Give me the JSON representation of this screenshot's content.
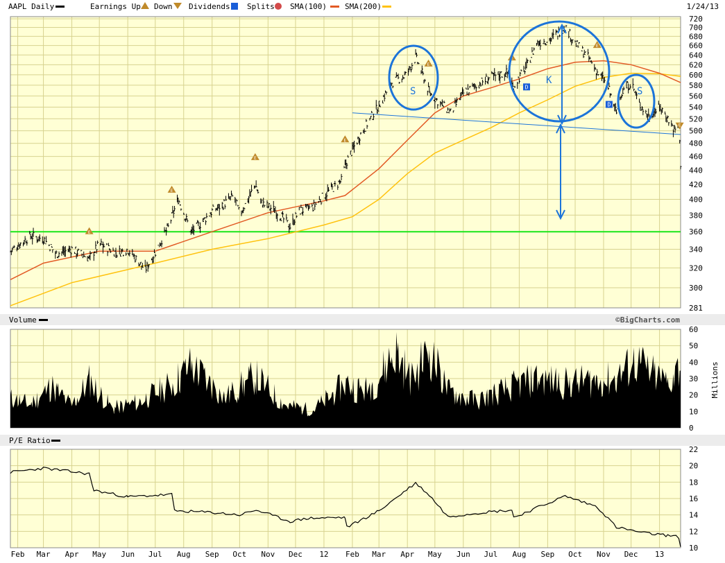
{
  "header": {
    "symbol_label": "AAPL Daily",
    "earnings_label": "Earnings Up",
    "down_label": "Down",
    "dividends_label": "Dividends",
    "splits_label": "Splits",
    "sma100_label": "SMA(100)",
    "sma200_label": "SMA(200)",
    "date": "1/24/13"
  },
  "panels": {
    "volume_label": "Volume",
    "volume_unit": "Millions",
    "pe_label": "P/E Ratio",
    "credit": "©BigCharts.com"
  },
  "colors": {
    "panel_bg": "#ffffd5",
    "grid": "#d7d28f",
    "sma100": "#e25a25",
    "sma200": "#ffc20e",
    "support": "#19e619",
    "annotation": "#1c74d9",
    "earnings_marker": "#c08a2a",
    "dividend_marker": "#1a5ed8"
  },
  "annotations": {
    "left_shoulder": "S",
    "head": "K",
    "right_shoulder": "S"
  },
  "markers": {
    "earnings_glyph": "E",
    "dividend_glyph": "D"
  },
  "chart_data": [
    {
      "type": "line",
      "panel": "price",
      "scale": "log",
      "y_ticks": [
        281,
        300,
        320,
        340,
        360,
        380,
        400,
        420,
        440,
        460,
        480,
        500,
        520,
        540,
        560,
        580,
        600,
        620,
        640,
        660,
        680,
        700,
        720
      ],
      "ylim": [
        281,
        725
      ],
      "x_labels": [
        "Feb",
        "Mar",
        "Apr",
        "May",
        "Jun",
        "Jul",
        "Aug",
        "Sep",
        "Oct",
        "Nov",
        "Dec",
        "12",
        "Feb",
        "Mar",
        "Apr",
        "May",
        "Jun",
        "Jul",
        "Aug",
        "Sep",
        "Oct",
        "Nov",
        "Dec",
        "13"
      ],
      "x_start": "2011-01-24",
      "x_end": "2013-01-24",
      "series": [
        {
          "name": "AAPL Daily",
          "style": "ohlc",
          "points": [
            [
              "2011-01-24",
              338
            ],
            [
              "2011-02-15",
              355
            ],
            [
              "2011-03-01",
              352
            ],
            [
              "2011-03-15",
              335
            ],
            [
              "2011-04-01",
              340
            ],
            [
              "2011-04-20",
              330
            ],
            [
              "2011-05-01",
              346
            ],
            [
              "2011-05-20",
              336
            ],
            [
              "2011-06-01",
              340
            ],
            [
              "2011-06-20",
              318
            ],
            [
              "2011-06-30",
              335
            ],
            [
              "2011-07-15",
              365
            ],
            [
              "2011-07-26",
              400
            ],
            [
              "2011-08-09",
              360
            ],
            [
              "2011-08-20",
              370
            ],
            [
              "2011-09-01",
              385
            ],
            [
              "2011-09-15",
              395
            ],
            [
              "2011-09-25",
              405
            ],
            [
              "2011-10-01",
              380
            ],
            [
              "2011-10-10",
              400
            ],
            [
              "2011-10-18",
              420
            ],
            [
              "2011-10-25",
              395
            ],
            [
              "2011-11-10",
              385
            ],
            [
              "2011-11-25",
              366
            ],
            [
              "2011-12-05",
              385
            ],
            [
              "2011-12-20",
              390
            ],
            [
              "2012-01-01",
              405
            ],
            [
              "2012-01-20",
              425
            ],
            [
              "2012-01-25",
              450
            ],
            [
              "2012-02-10",
              495
            ],
            [
              "2012-02-29",
              540
            ],
            [
              "2012-03-15",
              585
            ],
            [
              "2012-03-31",
              600
            ],
            [
              "2012-04-10",
              635
            ],
            [
              "2012-04-25",
              565
            ],
            [
              "2012-05-18",
              530
            ],
            [
              "2012-06-01",
              565
            ],
            [
              "2012-06-20",
              585
            ],
            [
              "2012-07-01",
              595
            ],
            [
              "2012-07-20",
              605
            ],
            [
              "2012-07-25",
              575
            ],
            [
              "2012-08-10",
              620
            ],
            [
              "2012-08-20",
              665
            ],
            [
              "2012-09-05",
              675
            ],
            [
              "2012-09-20",
              702
            ],
            [
              "2012-10-01",
              665
            ],
            [
              "2012-10-15",
              635
            ],
            [
              "2012-10-25",
              605
            ],
            [
              "2012-11-05",
              580
            ],
            [
              "2012-11-15",
              530
            ],
            [
              "2012-11-20",
              565
            ],
            [
              "2012-12-01",
              585
            ],
            [
              "2012-12-10",
              545
            ],
            [
              "2012-12-20",
              525
            ],
            [
              "2013-01-02",
              540
            ],
            [
              "2013-01-10",
              520
            ],
            [
              "2013-01-18",
              500
            ],
            [
              "2013-01-22",
              510
            ],
            [
              "2013-01-24",
              450
            ]
          ]
        },
        {
          "name": "SMA(100)",
          "points": [
            [
              "2011-01-24",
              308
            ],
            [
              "2011-03-01",
              325
            ],
            [
              "2011-05-01",
              338
            ],
            [
              "2011-07-01",
              338
            ],
            [
              "2011-09-01",
              360
            ],
            [
              "2011-11-01",
              383
            ],
            [
              "2012-01-01",
              398
            ],
            [
              "2012-01-24",
              405
            ],
            [
              "2012-03-01",
              442
            ],
            [
              "2012-04-01",
              485
            ],
            [
              "2012-05-01",
              530
            ],
            [
              "2012-06-01",
              560
            ],
            [
              "2012-07-01",
              575
            ],
            [
              "2012-08-01",
              592
            ],
            [
              "2012-09-01",
              612
            ],
            [
              "2012-10-01",
              625
            ],
            [
              "2012-11-01",
              628
            ],
            [
              "2012-12-01",
              620
            ],
            [
              "2013-01-01",
              603
            ],
            [
              "2013-01-24",
              585
            ]
          ]
        },
        {
          "name": "SMA(200)",
          "points": [
            [
              "2011-01-24",
              283
            ],
            [
              "2011-04-01",
              305
            ],
            [
              "2011-07-01",
              325
            ],
            [
              "2011-09-01",
              340
            ],
            [
              "2011-11-01",
              352
            ],
            [
              "2012-01-01",
              368
            ],
            [
              "2012-02-01",
              378
            ],
            [
              "2012-03-01",
              400
            ],
            [
              "2012-04-01",
              435
            ],
            [
              "2012-05-01",
              465
            ],
            [
              "2012-06-01",
              485
            ],
            [
              "2012-07-01",
              505
            ],
            [
              "2012-08-01",
              530
            ],
            [
              "2012-09-01",
              553
            ],
            [
              "2012-10-01",
              578
            ],
            [
              "2012-11-01",
              595
            ],
            [
              "2012-12-01",
              603
            ],
            [
              "2013-01-01",
              602
            ],
            [
              "2013-01-24",
              597
            ]
          ]
        },
        {
          "name": "Support",
          "points": [
            [
              "2011-01-24",
              360
            ],
            [
              "2013-01-24",
              360
            ]
          ]
        },
        {
          "name": "Neckline",
          "points": [
            [
              "2012-02-01",
              530
            ],
            [
              "2013-01-24",
              494
            ]
          ]
        }
      ],
      "earnings_up": [
        "2011-04-20",
        "2011-07-19",
        "2011-10-18",
        "2012-01-24",
        "2012-04-24",
        "2012-07-24",
        "2012-10-25"
      ],
      "earnings_down": [
        "2013-01-23"
      ],
      "dividends": [
        "2012-08-09",
        "2012-11-07"
      ]
    },
    {
      "type": "area",
      "panel": "volume",
      "ylabel": "Millions",
      "y_ticks": [
        0,
        10,
        20,
        30,
        40,
        50,
        60
      ],
      "ylim": [
        0,
        60
      ],
      "series": [
        {
          "name": "Volume",
          "points": [
            [
              "2011-01-24",
              20
            ],
            [
              "2011-02-15",
              16
            ],
            [
              "2011-03-10",
              28
            ],
            [
              "2011-04-01",
              15
            ],
            [
              "2011-04-20",
              32
            ],
            [
              "2011-05-15",
              13
            ],
            [
              "2011-06-15",
              18
            ],
            [
              "2011-07-20",
              30
            ],
            [
              "2011-08-09",
              42
            ],
            [
              "2011-09-15",
              20
            ],
            [
              "2011-10-18",
              35
            ],
            [
              "2011-11-20",
              15
            ],
            [
              "2011-12-20",
              12
            ],
            [
              "2012-01-25",
              30
            ],
            [
              "2012-02-15",
              25
            ],
            [
              "2012-03-01",
              34
            ],
            [
              "2012-03-19",
              53
            ],
            [
              "2012-04-05",
              32
            ],
            [
              "2012-04-25",
              52
            ],
            [
              "2012-05-15",
              25
            ],
            [
              "2012-06-15",
              18
            ],
            [
              "2012-07-25",
              28
            ],
            [
              "2012-08-20",
              33
            ],
            [
              "2012-09-20",
              30
            ],
            [
              "2012-10-25",
              32
            ],
            [
              "2012-11-15",
              33
            ],
            [
              "2012-12-05",
              45
            ],
            [
              "2012-12-20",
              38
            ],
            [
              "2013-01-10",
              30
            ],
            [
              "2013-01-24",
              42
            ]
          ]
        }
      ]
    },
    {
      "type": "line",
      "panel": "pe",
      "y_ticks": [
        10,
        12,
        14,
        16,
        18,
        20,
        22
      ],
      "ylim": [
        10,
        22
      ],
      "series": [
        {
          "name": "P/E Ratio",
          "points": [
            [
              "2011-01-24",
              19.2
            ],
            [
              "2011-03-01",
              19.7
            ],
            [
              "2011-04-20",
              19.0
            ],
            [
              "2011-04-25",
              17.0
            ],
            [
              "2011-06-01",
              16.2
            ],
            [
              "2011-07-19",
              16.5
            ],
            [
              "2011-07-22",
              14.5
            ],
            [
              "2011-09-01",
              14.3
            ],
            [
              "2011-10-01",
              14.0
            ],
            [
              "2011-10-19",
              14.6
            ],
            [
              "2011-11-25",
              13.2
            ],
            [
              "2011-12-15",
              13.6
            ],
            [
              "2012-01-24",
              13.7
            ],
            [
              "2012-01-26",
              12.5
            ],
            [
              "2012-03-01",
              14.5
            ],
            [
              "2012-04-10",
              17.9
            ],
            [
              "2012-04-25",
              16.4
            ],
            [
              "2012-05-15",
              13.8
            ],
            [
              "2012-06-20",
              14.3
            ],
            [
              "2012-07-24",
              14.6
            ],
            [
              "2012-07-26",
              13.7
            ],
            [
              "2012-09-20",
              16.3
            ],
            [
              "2012-10-25",
              15.0
            ],
            [
              "2012-11-15",
              12.5
            ],
            [
              "2012-12-15",
              11.8
            ],
            [
              "2013-01-10",
              11.5
            ],
            [
              "2013-01-22",
              11.3
            ],
            [
              "2013-01-24",
              10.1
            ]
          ]
        }
      ]
    }
  ]
}
